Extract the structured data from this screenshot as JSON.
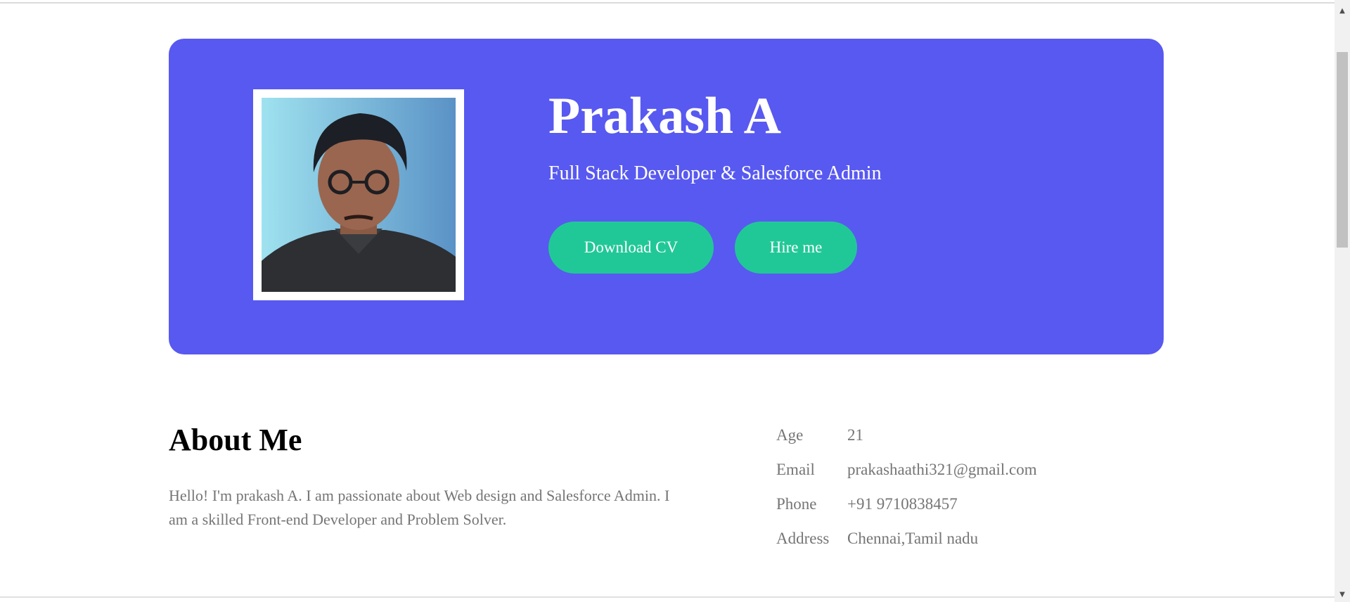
{
  "hero": {
    "name": "Prakash A",
    "title": "Full Stack Developer & Salesforce Admin",
    "download_label": "Download CV",
    "hire_label": "Hire me",
    "bg_color": "#5859f0",
    "button_color": "#21c897"
  },
  "about": {
    "heading": "About Me",
    "text": "Hello! I'm prakash A. I am passionate about Web design and Salesforce Admin. I am a skilled Front-end Developer and Problem Solver.",
    "info": [
      {
        "label": "Age",
        "value": "21"
      },
      {
        "label": "Email",
        "value": "prakashaathi321@gmail.com"
      },
      {
        "label": "Phone",
        "value": "+91 9710838457"
      },
      {
        "label": "Address",
        "value": "Chennai,Tamil nadu"
      }
    ]
  },
  "icons": {
    "scroll_up": "scroll-up-arrow-icon",
    "scroll_down": "scroll-down-arrow-icon"
  }
}
